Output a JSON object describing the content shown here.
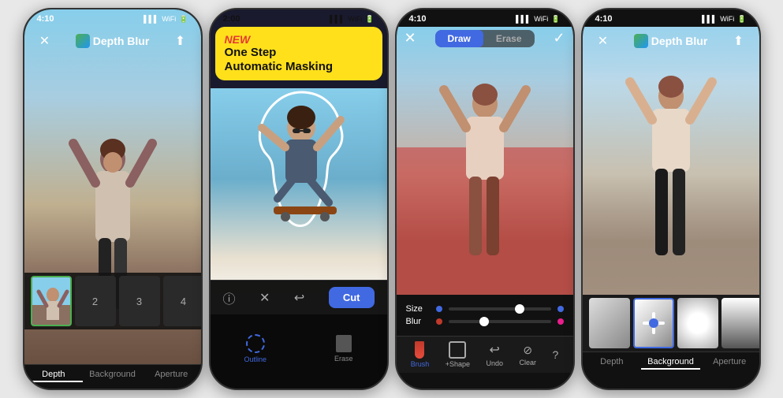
{
  "screen1": {
    "time": "4:10",
    "title": "Depth Blur",
    "tabs": [
      {
        "label": "Depth",
        "active": true
      },
      {
        "label": "Background",
        "active": false
      },
      {
        "label": "Aperture",
        "active": false
      }
    ],
    "thumbNumbers": [
      "",
      "2",
      "3",
      "4"
    ]
  },
  "screen2": {
    "time": "2:00",
    "badge": "NEW",
    "title": "One Step\nAutomatic Masking",
    "cutButton": "Cut",
    "tools": [
      "Outline",
      "Erase"
    ]
  },
  "screen3": {
    "time": "4:10",
    "drawLabel": "Draw",
    "eraseLabel": "Erase",
    "size": "Size",
    "blur": "Blur",
    "tools": [
      "Brush",
      "+Shape",
      "Undo",
      "Clear"
    ]
  },
  "screen4": {
    "time": "4:10",
    "title": "Depth Blur",
    "tabs": [
      {
        "label": "Depth",
        "active": false
      },
      {
        "label": "Background",
        "active": true
      },
      {
        "label": "Aperture",
        "active": false
      }
    ]
  }
}
